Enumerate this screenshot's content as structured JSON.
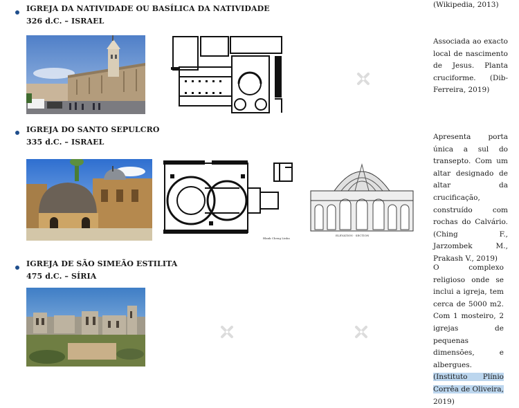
{
  "entries": [
    {
      "title": "IGREJA DA NATIVIDADE OU BASÍLICA DA NATIVIDADE",
      "subtitle": "326 d.C. – ISRAEL",
      "description": "Associada ao exacto local de nascimento de Jesus. Planta cruciforme. (Dib-Ferreira, 2019)"
    },
    {
      "title": "IGREJA DO SANTO SEPULCRO",
      "subtitle": "335 d.C. – ISRAEL",
      "description": "Apresenta porta única a sul do transepto. Com um altar designado de altar da crucificação, construído com rochas do Calvário. (Ching F., Jarzombek M., Prakash V., 2019)",
      "drawing_caption_left": "Blank Cheng Linha",
      "drawing_caption_right": "ELEVATION · SECTION"
    },
    {
      "title": "IGREJA DE SÃO SIMEÃO ESTILITA",
      "subtitle": "475 d.C. – SÍRIA",
      "description_main": "O complexo religioso onde se inclui a igreja, tem cerca de 5000 m2. Com 1 mosteiro, 2 igrejas de pequenas dimensões, e albergues.",
      "description_citation": "(Instituto Plínio Corrêa de Oliveira,",
      "description_year": "2019)"
    }
  ],
  "top_citation": "(Wikipedia, 2013)",
  "colors": {
    "bullet": "#1f4e8c",
    "highlight": "#bcd6ee"
  }
}
